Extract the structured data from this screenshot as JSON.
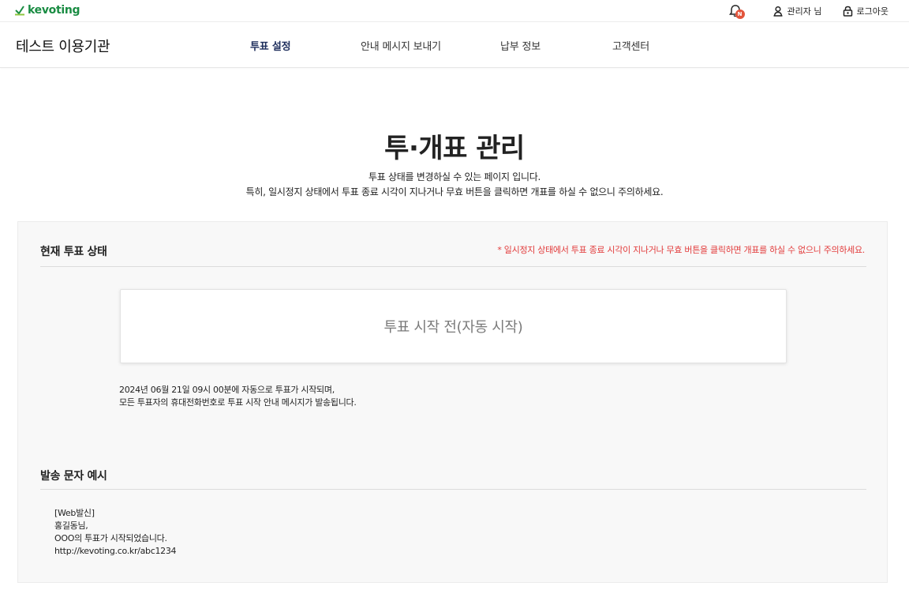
{
  "brand": {
    "logo_text": "kevoting",
    "accent_color": "#1a8c43"
  },
  "topbar": {
    "notification_badge": "N",
    "admin_label": "관리자 님",
    "logout_label": "로그아웃"
  },
  "nav": {
    "org_name": "테스트 이용기관",
    "items": [
      {
        "label": "투표 설정"
      },
      {
        "label": "안내 메시지 보내기"
      },
      {
        "label": "납부 정보"
      },
      {
        "label": "고객센터"
      }
    ]
  },
  "header": {
    "title": "투·개표 관리",
    "desc_line1": "투표 상태를 변경하실 수 있는 페이지 입니다.",
    "desc_line2": "특히, 일시정지 상태에서 투표 종료 시각이 지나거나 무효 버튼을 클릭하면 개표를 하실 수 없으니 주의하세요."
  },
  "status_section": {
    "title": "현재 투표 상태",
    "warning": "* 일시정지 상태에서 투표 종료 시각이 지나거나 무효 버튼을 클릭하면 개표를 하실 수 없으니 주의하세요.",
    "status_text": "투표 시작 전(자동 시작)",
    "note_line1": "2024년 06월 21일 09시 00분에 자동으로 투표가 시작되며,",
    "note_line2": "모든 투표자의 휴대전화번호로 투표 시작 안내 메시지가 발송됩니다."
  },
  "sms_section": {
    "title": "발송 문자 예시",
    "lines": [
      "[Web발신]",
      "홍길동님,",
      "OOO의 투표가 시작되었습니다.",
      "http://kevoting.co.kr/abc1234"
    ]
  }
}
